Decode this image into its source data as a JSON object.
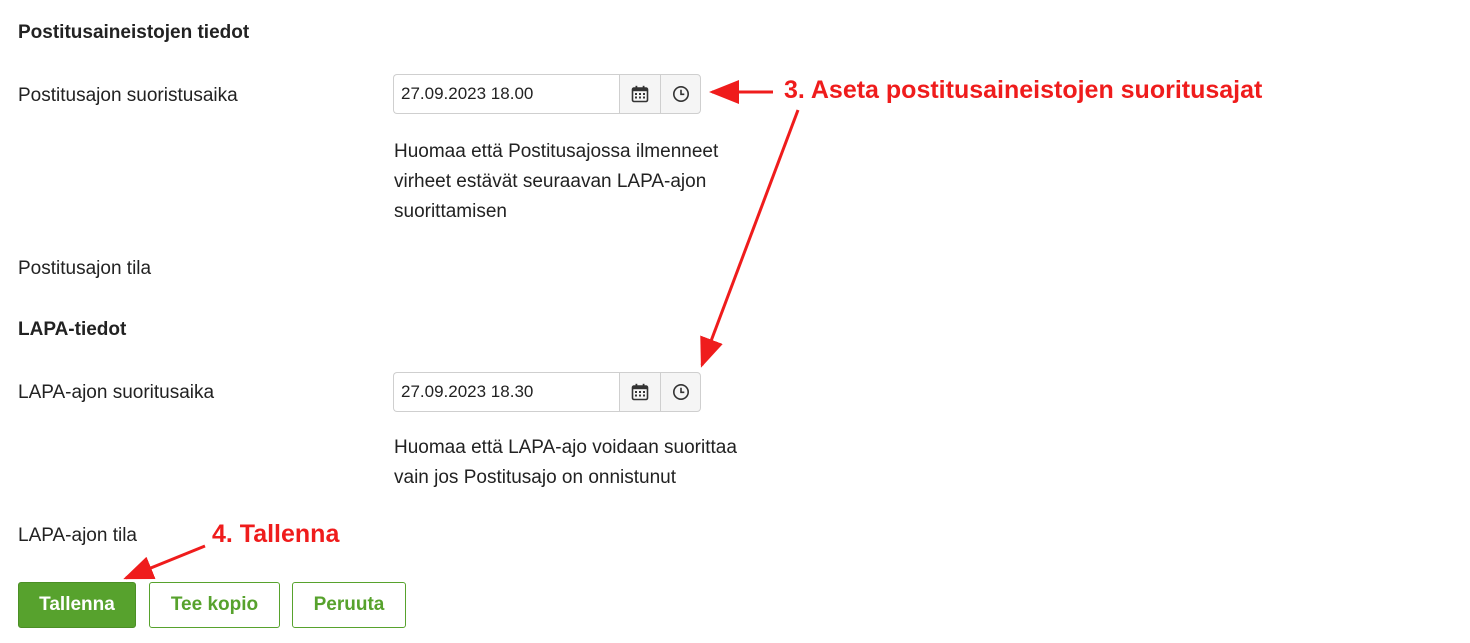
{
  "sections": {
    "posting_heading": "Postitusaineistojen tiedot",
    "lapa_heading": "LAPA-tiedot"
  },
  "posting": {
    "run_time_label": "Postitusajon suoristusaika",
    "run_time_value": "27.09.2023 18.00",
    "note": "Huomaa että Postitusajossa ilmenneet virheet estävät seuraavan LAPA-ajon suorittamisen",
    "status_label": "Postitusajon tila"
  },
  "lapa": {
    "run_time_label": "LAPA-ajon suoritusaika",
    "run_time_value": "27.09.2023 18.30",
    "note": "Huomaa että LAPA-ajo voidaan suorittaa vain jos Postitusajo on onnistunut",
    "status_label": "LAPA-ajon tila"
  },
  "buttons": {
    "save": "Tallenna",
    "copy": "Tee kopio",
    "cancel": "Peruuta"
  },
  "annotations": {
    "step3": "3. Aseta postitusaineistojen suoritusajat",
    "step4": "4. Tallenna"
  },
  "icons": {
    "calendar": "calendar-icon",
    "clock": "clock-icon"
  },
  "colors": {
    "primary_green": "#57a22d",
    "annotation_red": "#ef1c1c",
    "text": "#222222",
    "border": "#cfcfcf"
  }
}
